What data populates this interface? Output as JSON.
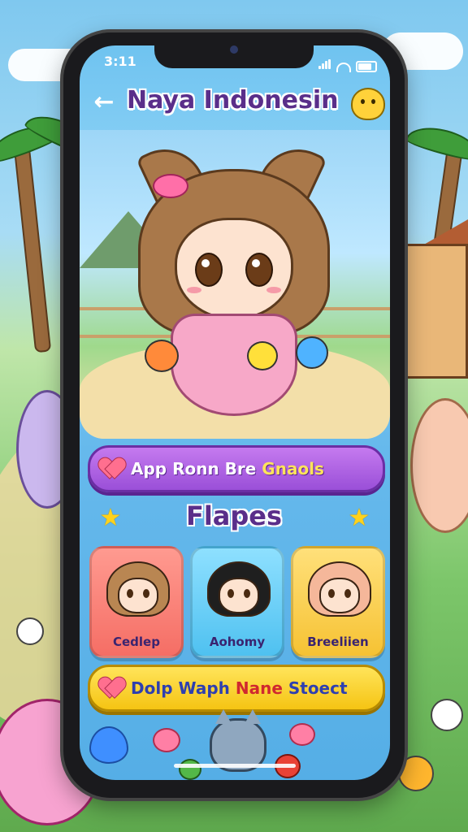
{
  "status_bar": {
    "time": "3:11"
  },
  "header": {
    "title": "Naya Indonesin",
    "back_icon": "arrow-left-icon",
    "mascot_icon": "yellow-chick-mascot-icon"
  },
  "primary_pill": {
    "label_main": "App Ronn Bre ",
    "label_highlight": "Gnaols",
    "icon": "heart-icon"
  },
  "section": {
    "title": "Flapes"
  },
  "characters": [
    {
      "label": "Cedlep",
      "card_color": "#f56e65",
      "hair_color": "#b98652"
    },
    {
      "label": "Aohomy",
      "card_color": "#4fc1f0",
      "hair_color": "#1f1f1f"
    },
    {
      "label": "Breeliien",
      "card_color": "#f6c233",
      "hair_color": "#f5b79a"
    }
  ],
  "secondary_pill": {
    "label_main": "Dolp Waph ",
    "label_highlight": "Nane",
    "label_tail": " Stoect",
    "icon": "heart-icon"
  },
  "colors": {
    "title_purple": "#5a2e8a",
    "pill_purple": "#9a4fd8",
    "pill_yellow": "#f5c413",
    "screen_blue": "#66b9ec"
  }
}
